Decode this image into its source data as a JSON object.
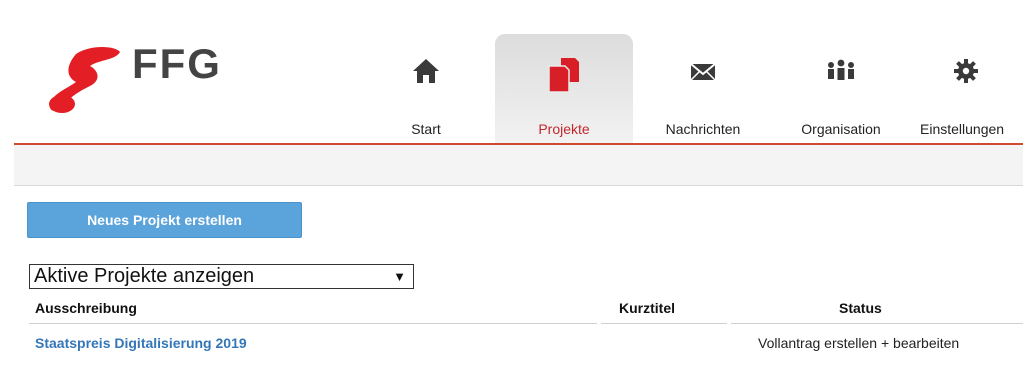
{
  "brand": {
    "logo_text": "FFG",
    "accent": "#e31e25",
    "line_color": "#d24a2e"
  },
  "nav": {
    "items": [
      {
        "label": "Start",
        "icon": "home-icon",
        "active": false
      },
      {
        "label": "Projekte",
        "icon": "documents-icon",
        "active": true
      },
      {
        "label": "Nachrichten",
        "icon": "envelope-icon",
        "active": false
      },
      {
        "label": "Organisation",
        "icon": "people-icon",
        "active": false
      },
      {
        "label": "Einstellungen",
        "icon": "gear-icon",
        "active": false
      }
    ]
  },
  "actions": {
    "new_project_label": "Neues Projekt erstellen"
  },
  "filter": {
    "selected": "Aktive Projekte anzeigen",
    "arrow": "▼"
  },
  "table": {
    "headers": {
      "ausschreibung": "Ausschreibung",
      "kurztitel": "Kurztitel",
      "status": "Status"
    },
    "rows": [
      {
        "ausschreibung": "Staatspreis Digitalisierung 2019",
        "kurztitel": "",
        "status": "Vollantrag erstellen + bearbeiten"
      }
    ]
  }
}
